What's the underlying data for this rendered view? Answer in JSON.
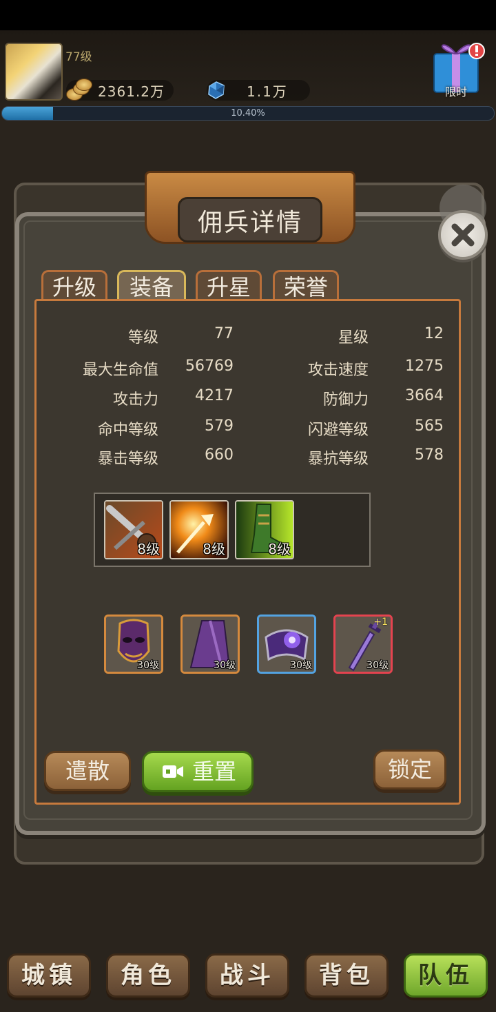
{
  "player": {
    "level": "77级",
    "coins": "2361.2万",
    "gems": "1.1万",
    "progress_text": "10.40%",
    "progress_fraction": 0.104,
    "gift_label": "限时"
  },
  "panel": {
    "title": "佣兵详情",
    "tabs": [
      "升级",
      "装备",
      "升星",
      "荣誉"
    ],
    "active_tab": "装备"
  },
  "stats": {
    "left": [
      {
        "label": "等级",
        "value": "77"
      },
      {
        "label": "最大生命值",
        "value": "56769"
      },
      {
        "label": "攻击力",
        "value": "4217"
      },
      {
        "label": "命中等级",
        "value": "579"
      },
      {
        "label": "暴击等级",
        "value": "660"
      }
    ],
    "right": [
      {
        "label": "星级",
        "value": "12"
      },
      {
        "label": "攻击速度",
        "value": "1275"
      },
      {
        "label": "防御力",
        "value": "3664"
      },
      {
        "label": "闪避等级",
        "value": "565"
      },
      {
        "label": "暴抗等级",
        "value": "578"
      }
    ]
  },
  "skills": [
    {
      "name": "sword-skill",
      "level": "8级"
    },
    {
      "name": "fire-arrow-skill",
      "level": "8级"
    },
    {
      "name": "boot-skill",
      "level": "8级"
    }
  ],
  "equipment": [
    {
      "name": "mask",
      "level": "30级",
      "rarity": "orange"
    },
    {
      "name": "cloak",
      "level": "30级",
      "rarity": "orange"
    },
    {
      "name": "bracer",
      "level": "30级",
      "rarity": "blue"
    },
    {
      "name": "dagger",
      "level": "30级",
      "rarity": "red",
      "plus": "+1"
    }
  ],
  "actions": {
    "dismiss": "遣散",
    "reset": "重置",
    "lock": "锁定"
  },
  "nav": [
    "城镇",
    "角色",
    "战斗",
    "背包",
    "队伍"
  ],
  "nav_active": "队伍",
  "colors": {
    "tab_border": "#b86f3a",
    "accent_green": "#6fa72b",
    "progress_blue": "#4aa3d8"
  }
}
